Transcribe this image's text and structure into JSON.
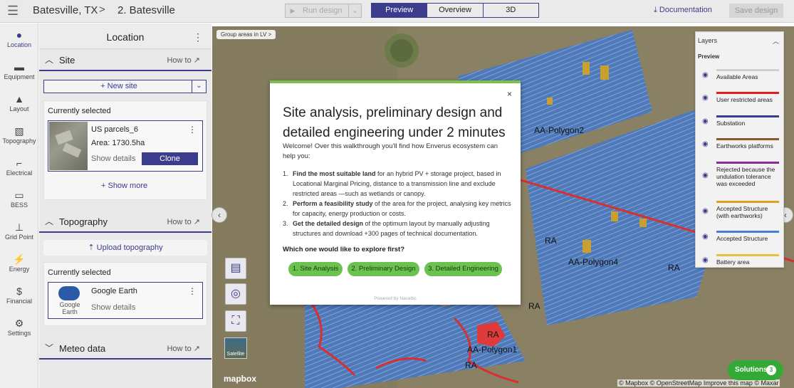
{
  "header": {
    "project": "Batesville, TX",
    "separator": ">",
    "design": "2. Batesville",
    "run_label": "Run design",
    "tabs": [
      "Preview",
      "Overview",
      "3D"
    ],
    "active_tab": "Preview",
    "documentation": "Documentation",
    "save": "Save design"
  },
  "rail": [
    {
      "label": "Location",
      "icon": "location-pin-icon"
    },
    {
      "label": "Equipment",
      "icon": "equipment-icon"
    },
    {
      "label": "Layout",
      "icon": "layout-icon"
    },
    {
      "label": "Topography",
      "icon": "topography-icon"
    },
    {
      "label": "Electrical",
      "icon": "electrical-icon"
    },
    {
      "label": "BESS",
      "icon": "bess-icon"
    },
    {
      "label": "Grid Point",
      "icon": "grid-point-icon"
    },
    {
      "label": "Energy",
      "icon": "energy-icon"
    },
    {
      "label": "Financial",
      "icon": "financial-icon"
    },
    {
      "label": "Settings",
      "icon": "settings-icon"
    }
  ],
  "panel": {
    "title": "Location",
    "site": {
      "title": "Site",
      "howto": "How to",
      "new_site": "+ New site",
      "currently_selected": "Currently selected",
      "name": "US parcels_6",
      "area": "Area: 1730.5ha",
      "show_details": "Show details",
      "clone": "Clone",
      "show_more": "+ Show more"
    },
    "topography": {
      "title": "Topography",
      "howto": "How to",
      "upload": "Upload topography",
      "currently_selected": "Currently selected",
      "name": "Google Earth",
      "logo_text": "Google Earth",
      "show_details": "Show details"
    },
    "meteo": {
      "title": "Meteo data",
      "howto": "How to"
    }
  },
  "map": {
    "group_chip": "Group areas in LV >",
    "labels": [
      "AA-Polygon2",
      "AA-Polygon4",
      "AA-Polygon1",
      "RA",
      "RA",
      "RA",
      "RA",
      "RA"
    ],
    "satellite": "Satellite",
    "mapbox": "mapbox",
    "attribution": "© Mapbox © OpenStreetMap  Improve this map © Maxar"
  },
  "modal": {
    "close": "×",
    "title": "Site analysis, preliminary design and detailed engineering under 2 minutes",
    "welcome": "Welcome! Over this walkthrough you'll find how Enverus ecosystem can help you:",
    "items": [
      {
        "num": "1.",
        "bold": "Find the most suitable land",
        "rest": " for an hybrid PV + storage project, based in Locational Marginal Pricing, distance to a transmission line and exclude restricted areas —such as wetlands or canopy."
      },
      {
        "num": "2.",
        "bold": "Perform a feasibility study",
        "rest": " of the area for the project, analysing key metrics for capacity, energy production or costs."
      },
      {
        "num": "3.",
        "bold": "Get the detailed design",
        "rest": " of the optimum layout by manually adjusting structures and download +300 pages of technical documentation."
      }
    ],
    "question": "Which one would like to explore first?",
    "buttons": [
      "1. Site Analysis",
      "2. Preliminary Design",
      "3. Detailed Engineering"
    ],
    "powered": "Powered by Navattic"
  },
  "layers": {
    "title": "Layers",
    "preview": "Preview",
    "items": [
      {
        "label": "Available Areas",
        "color": "#cfcfcf"
      },
      {
        "label": "User restricted areas",
        "color": "#e02020"
      },
      {
        "label": "Substation",
        "color": "#3c3c8c"
      },
      {
        "label": "Earthworks platforms",
        "color": "#8b5a2b"
      },
      {
        "label": "Rejected because the undulation tolerance was exceeded",
        "color": "#8b2b9c"
      },
      {
        "label": "Accepted Structure (with earthworks)",
        "color": "#e0a020"
      },
      {
        "label": "Accepted Structure",
        "color": "#4a7fd0"
      },
      {
        "label": "Battery area",
        "color": "#e8c040"
      }
    ]
  },
  "solutions": {
    "label": "Solutions",
    "count": "3"
  }
}
